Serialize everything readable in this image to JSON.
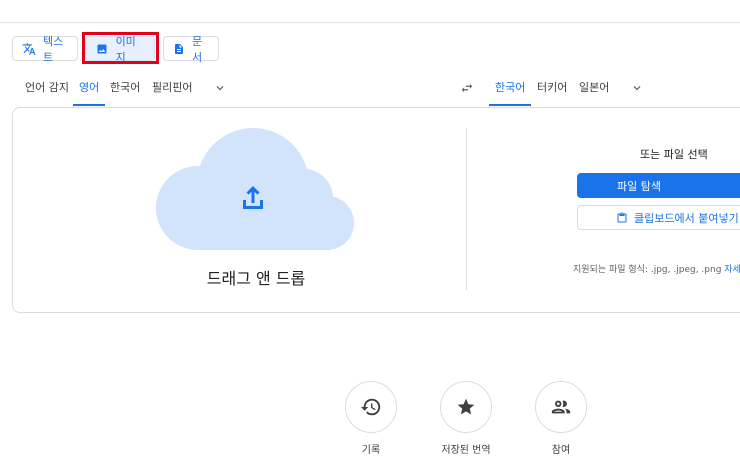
{
  "modes": {
    "text_label": "텍스트",
    "image_label": "이미지",
    "document_label": "문서"
  },
  "source_langs": [
    "언어 감지",
    "영어",
    "한국어",
    "필리핀어"
  ],
  "target_langs": [
    "한국어",
    "터키어",
    "일본어"
  ],
  "upload": {
    "drop_label": "드래그 앤 드롭",
    "or_label": "또는 파일 선택",
    "browse_label": "파일 탐색",
    "paste_label": "클립보드에서 붙여넣기",
    "supported_text": "지원되는 파일 형식: .jpg, .jpeg, .png",
    "learn_more": "자세히"
  },
  "bottom": {
    "history_label": "기록",
    "saved_label": "저장된 번역",
    "contribute_label": "참여"
  },
  "colors": {
    "accent": "#1a73e8",
    "cloud": "#d2e3fc",
    "highlight": "#e3001b"
  }
}
